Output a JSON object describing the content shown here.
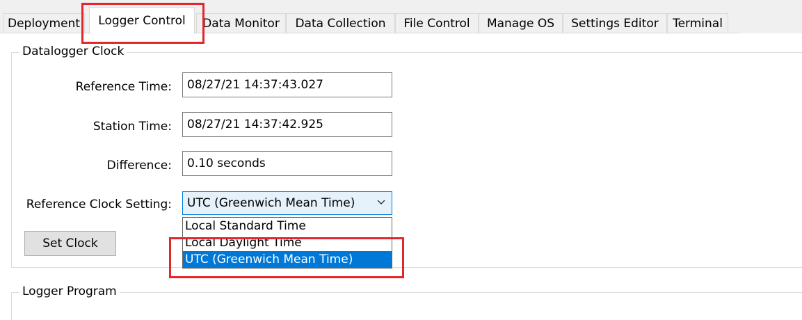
{
  "tabs": [
    {
      "label": "Deployment"
    },
    {
      "label": "Logger Control"
    },
    {
      "label": "Data Monitor"
    },
    {
      "label": "Data Collection"
    },
    {
      "label": "File Control"
    },
    {
      "label": "Manage OS"
    },
    {
      "label": "Settings Editor"
    },
    {
      "label": "Terminal"
    }
  ],
  "active_tab": "Logger Control",
  "clock_group": {
    "title": "Datalogger Clock",
    "reference_time_label": "Reference Time:",
    "reference_time_value": "08/27/21 14:37:43.027",
    "station_time_label": "Station Time:",
    "station_time_value": "08/27/21 14:37:42.925",
    "difference_label": "Difference:",
    "difference_value": "0.10 seconds",
    "ref_clock_label": "Reference Clock Setting:",
    "ref_clock_value": "UTC (Greenwich Mean Time)",
    "ref_clock_options": [
      "Local Standard Time",
      "Local Daylight Time",
      "UTC (Greenwich Mean Time)"
    ],
    "ref_clock_selected_option": "UTC (Greenwich Mean Time)",
    "set_clock_button": "Set Clock"
  },
  "program_group": {
    "title": "Logger Program"
  },
  "colors": {
    "highlight": "#0078d7",
    "annotation": "#e3262b",
    "tab_bg": "#f0f0f0"
  }
}
